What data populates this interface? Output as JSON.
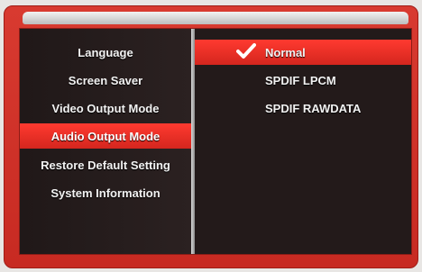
{
  "menu": {
    "items": [
      {
        "label": "Language"
      },
      {
        "label": "Screen Saver"
      },
      {
        "label": "Video Output Mode"
      },
      {
        "label": "Audio Output Mode"
      },
      {
        "label": "Restore Default Setting"
      },
      {
        "label": "System Information"
      }
    ],
    "selected_item": "Audio Output Mode"
  },
  "audio_output": {
    "options": [
      {
        "label": "Normal"
      },
      {
        "label": "SPDIF LPCM"
      },
      {
        "label": "SPDIF RAWDATA"
      }
    ],
    "selected_option": "Normal"
  },
  "colors": {
    "accent": "#ea2e25",
    "frame": "#d83a30",
    "panel": "#231a1a"
  },
  "icons": {
    "selected_marker": "checkmark-icon"
  }
}
